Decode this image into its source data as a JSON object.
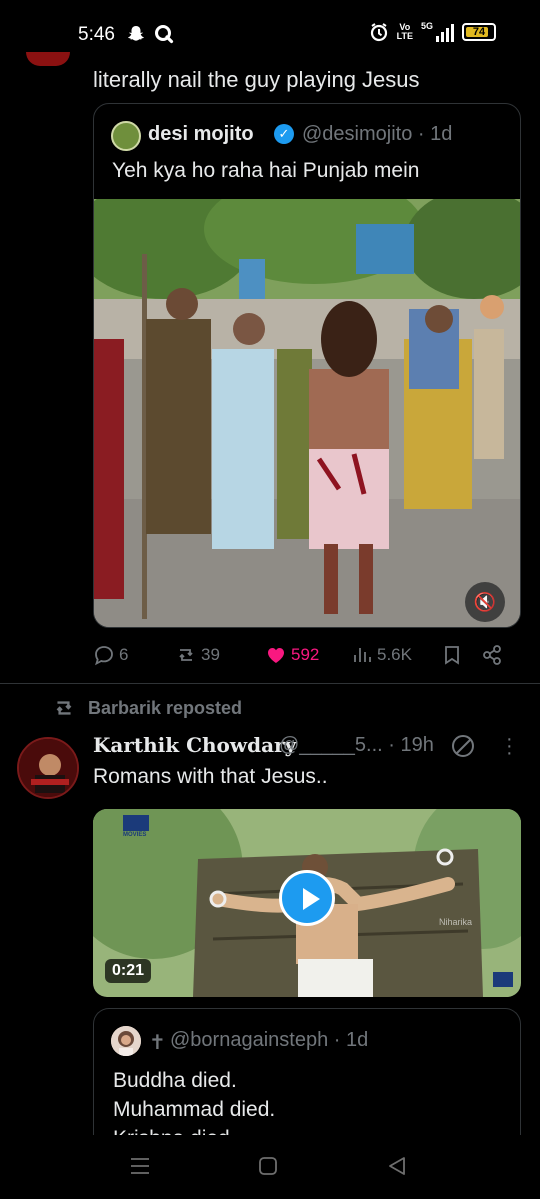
{
  "status_bar": {
    "time": "5:46",
    "network_top": "Vo",
    "network_bottom": "LTE",
    "network_type": "5G",
    "battery": "74"
  },
  "feed": {
    "previous_post_text": "literally nail the guy playing Jesus",
    "quote_post": {
      "name": "desi mojito",
      "handle": "@desimojito · 1d",
      "text": "Yeh kya ho raha hai Punjab mein"
    },
    "actions": {
      "replies": "6",
      "reposts": "39",
      "likes": "592",
      "views": "5.6K",
      "like_color": "#f91880"
    },
    "repost_label": "Barbarik reposted",
    "post": {
      "name": "Karthik Chowdary",
      "handle": "@_____5... · 19h",
      "text": "Romans with that Jesus..",
      "video_duration": "0:21",
      "watermark": "Niharika",
      "logo_caption": "MOVIES"
    },
    "nested_quote": {
      "handle": "@bornagainsteph · 1d",
      "cross": "✝",
      "lines": [
        "Buddha died.",
        "Muhammad died.",
        "Krishna died."
      ]
    }
  },
  "colors": {
    "accent": "#1d9bf0",
    "muted": "#71767b",
    "border": "#2f3336"
  }
}
